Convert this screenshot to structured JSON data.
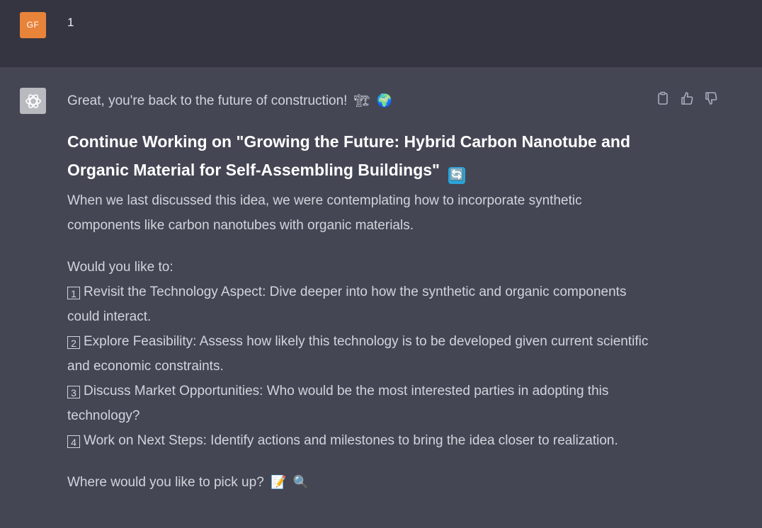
{
  "user": {
    "avatar_initials": "GF",
    "message": "1"
  },
  "assistant": {
    "intro": "Great, you're back to the future of construction!",
    "intro_emojis": [
      "🏗",
      "🌍"
    ],
    "heading": "Continue Working on \"Growing the Future: Hybrid Carbon Nanotube and Organic Material for Self-Assembling Buildings\"",
    "heading_emoji": "🔄",
    "paragraph": "When we last discussed this idea, we were contemplating how to incorporate synthetic components like carbon nanotubes with organic materials.",
    "prompt": "Would you like to:",
    "options": [
      {
        "num": "1",
        "text": "Revisit the Technology Aspect: Dive deeper into how the synthetic and organic components could interact."
      },
      {
        "num": "2",
        "text": "Explore Feasibility: Assess how likely this technology is to be developed given current scientific and economic constraints."
      },
      {
        "num": "3",
        "text": "Discuss Market Opportunities: Who would be the most interested parties in adopting this technology?"
      },
      {
        "num": "4",
        "text": "Work on Next Steps: Identify actions and milestones to bring the idea closer to realization."
      }
    ],
    "closing": "Where would you like to pick up?",
    "closing_emojis": [
      "📝",
      "🔍"
    ]
  },
  "colors": {
    "user_bg": "#343541",
    "assistant_bg": "#444654",
    "user_avatar": "#e8833a"
  },
  "icons": [
    "openai-logo-icon",
    "clipboard-icon",
    "thumbs-up-icon",
    "thumbs-down-icon"
  ]
}
